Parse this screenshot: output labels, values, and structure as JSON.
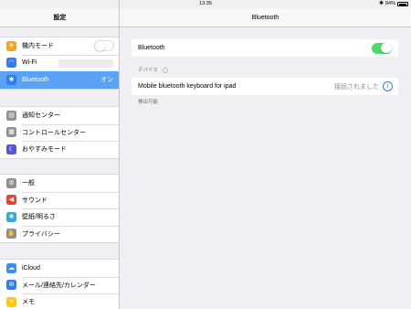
{
  "status_bar": {
    "device": "iPad",
    "time": "13:35",
    "battery": "84%",
    "battery_level": 0.84
  },
  "sidebar": {
    "title": "設定",
    "groups": [
      {
        "items": [
          {
            "label": "機内モード",
            "icon": "airplane-icon",
            "color": "#f5a623",
            "glyph": "✈"
          },
          {
            "label": "Wi-Fi",
            "icon": "wifi-icon",
            "color": "#2f7cf6",
            "glyph": "◠"
          },
          {
            "label": "Bluetooth",
            "icon": "bluetooth-icon",
            "color": "#2f7cf6",
            "glyph": "✱",
            "value": "オン",
            "selected": true
          }
        ]
      },
      {
        "items": [
          {
            "label": "通知センター",
            "icon": "notification-center-icon",
            "color": "#8e8e93",
            "glyph": "▤"
          },
          {
            "label": "コントロールセンター",
            "icon": "control-center-icon",
            "color": "#8e8e93",
            "glyph": "▦"
          },
          {
            "label": "おやすみモード",
            "icon": "moon-icon",
            "color": "#5856d6",
            "glyph": "☾"
          }
        ]
      },
      {
        "items": [
          {
            "label": "一般",
            "icon": "gear-icon",
            "color": "#8e8e93",
            "glyph": "⚙"
          },
          {
            "label": "サウンド",
            "icon": "speaker-icon",
            "color": "#ff3b30",
            "glyph": "◀"
          },
          {
            "label": "壁紙/明るさ",
            "icon": "wallpaper-icon",
            "color": "#34aadc",
            "glyph": "❋"
          },
          {
            "label": "プライバシー",
            "icon": "hand-icon",
            "color": "#8e8e93",
            "glyph": "✋"
          }
        ]
      },
      {
        "items": [
          {
            "label": "iCloud",
            "icon": "icloud-icon",
            "color": "#3b8cf5",
            "glyph": "☁"
          },
          {
            "label": "メール/連絡先/カレンダー",
            "icon": "mail-icon",
            "color": "#2f7cf6",
            "glyph": "✉"
          },
          {
            "label": "メモ",
            "icon": "notes-icon",
            "color": "#ffcc00",
            "glyph": "≡"
          }
        ]
      }
    ]
  },
  "main": {
    "title": "Bluetooth",
    "bluetooth_label": "Bluetooth",
    "bluetooth_on": true,
    "devices_header": "デバイス",
    "device_name": "Mobile bluetooth keyboard for ipad",
    "device_status": "接続されました",
    "discoverable_text": "検出可能"
  },
  "colors": {
    "accent": "#2f7cf6",
    "selected_row": "#5aa2f6",
    "toggle_on": "#4cd964"
  }
}
